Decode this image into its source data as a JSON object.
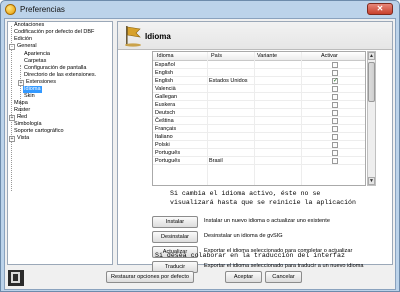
{
  "window": {
    "title": "Preferencias",
    "close_glyph": "✕"
  },
  "tree": {
    "items": [
      "Anotaciones",
      "Codificación por defecto del DBF",
      "Edición",
      "General",
      "Apariencia",
      "Carpetas",
      "Configuración de pantalla",
      "Directorio de las extensiones.",
      "Extensiones",
      "Idioma",
      "Skin",
      "Mapa",
      "Raster",
      "Red",
      "Simbología",
      "Soporte cartográfico",
      "Vista"
    ],
    "selected_index": 9
  },
  "panel": {
    "title": "Idioma",
    "icon": "language-flag-icon"
  },
  "table": {
    "columns": [
      "Idioma",
      "País",
      "Variante",
      "Activar"
    ],
    "rows": [
      {
        "idioma": "Español",
        "pais": "",
        "variante": "",
        "activar": false
      },
      {
        "idioma": "English",
        "pais": "",
        "variante": "",
        "activar": false
      },
      {
        "idioma": "English",
        "pais": "Estados Unidos",
        "variante": "",
        "activar": true
      },
      {
        "idioma": "Valencià",
        "pais": "",
        "variante": "",
        "activar": false
      },
      {
        "idioma": "Gallegan",
        "pais": "",
        "variante": "",
        "activar": false
      },
      {
        "idioma": "Euskera",
        "pais": "",
        "variante": "",
        "activar": false
      },
      {
        "idioma": "Deutsch",
        "pais": "",
        "variante": "",
        "activar": false
      },
      {
        "idioma": "Čeština",
        "pais": "",
        "variante": "",
        "activar": false
      },
      {
        "idioma": "Français",
        "pais": "",
        "variante": "",
        "activar": false
      },
      {
        "idioma": "Italiano",
        "pais": "",
        "variante": "",
        "activar": false
      },
      {
        "idioma": "Polski",
        "pais": "",
        "variante": "",
        "activar": false
      },
      {
        "idioma": "Português",
        "pais": "",
        "variante": "",
        "activar": false
      },
      {
        "idioma": "Português",
        "pais": "Brasil",
        "variante": "",
        "activar": false
      }
    ]
  },
  "notice": {
    "line1": "Si cambia el idioma activo, éste no se",
    "line2": "visualizará hasta que se reinicie la aplicación"
  },
  "actions": [
    {
      "label": "Instalar",
      "description": "Instalar un nuevo idioma o actualizar uno existente"
    },
    {
      "label": "Desinstalar",
      "description": "Desinstalar un idioma de gvSIG"
    },
    {
      "label": "Actualizar",
      "description": "Exportar el idioma seleccionado para completar o actualizar"
    },
    {
      "label": "Traducir",
      "description": "Exportar el idioma seleccionado para traducir a un nuevo idioma"
    }
  ],
  "footer_text": "Si desea colaborar en la traducción del interfaz",
  "bottom": {
    "restore_label": "Restaurar opciones por defecto",
    "accept_label": "Aceptar",
    "cancel_label": "Cancelar"
  },
  "scrollbar": {
    "up": "▲",
    "down": "▼"
  },
  "tree_expanders": {
    "collapse": "-",
    "expand": "+"
  },
  "colors": {
    "selection": "#3399ff",
    "window_frame": "#bcd3ea",
    "close_button": "#c8402c"
  }
}
